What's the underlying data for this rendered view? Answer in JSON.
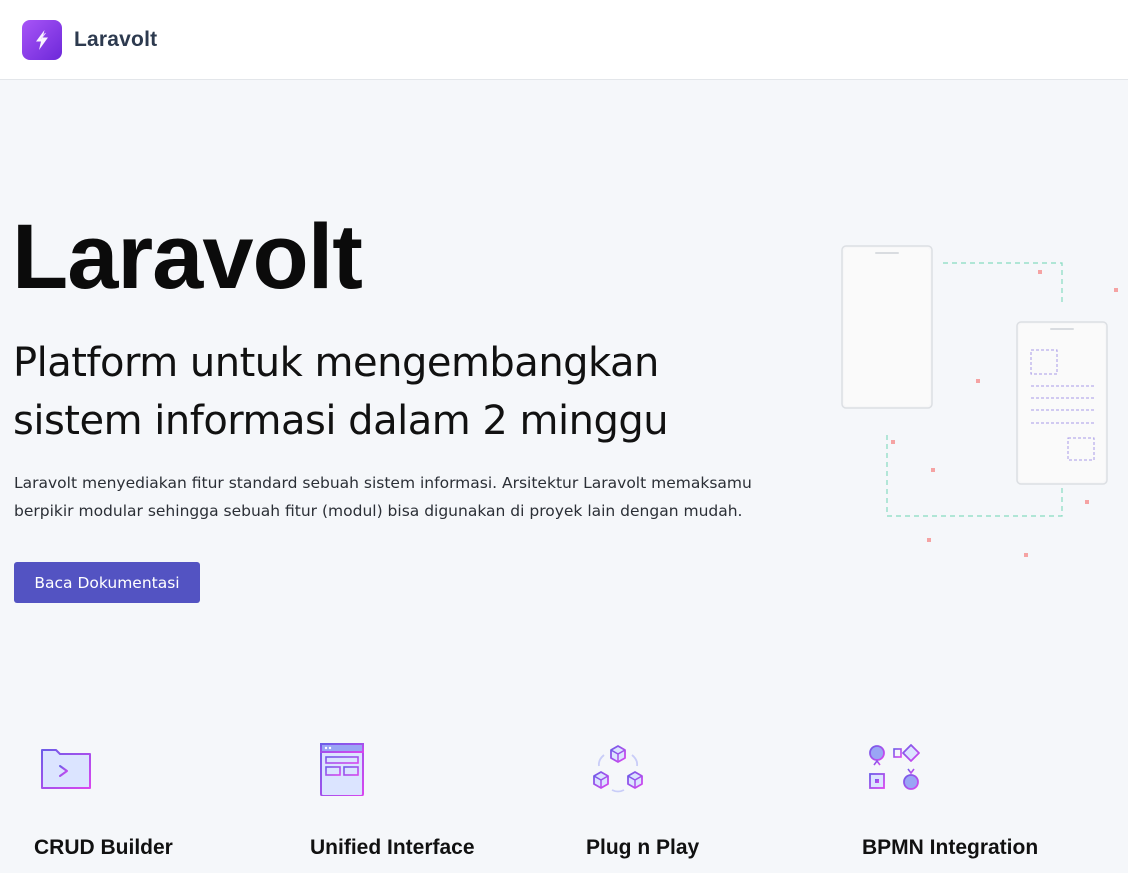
{
  "brand": {
    "name": "Laravolt"
  },
  "hero": {
    "title": "Laravolt",
    "subtitle_line1": "Platform untuk mengembangkan",
    "subtitle_line2": "sistem informasi dalam 2 minggu",
    "description_line1": "Laravolt menyediakan fitur standard sebuah sistem informasi. Arsitektur Laravolt memaksamu",
    "description_line2": "berpikir modular sehingga sebuah fitur (modul) bisa digunakan di proyek lain dengan mudah.",
    "cta_label": "Baca Dokumentasi"
  },
  "features": [
    {
      "title": "CRUD Builder",
      "icon": "folder-terminal-icon"
    },
    {
      "title": "Unified Interface",
      "icon": "layout-window-icon"
    },
    {
      "title": "Plug n Play",
      "icon": "cubes-icon"
    },
    {
      "title": "BPMN Integration",
      "icon": "workflow-icon"
    }
  ],
  "colors": {
    "accent": "#5353c2",
    "logo_gradient_start": "#a855f7",
    "logo_gradient_end": "#6d28d9",
    "icon_gradient_start": "#6d5ce8",
    "icon_gradient_end": "#d946ef"
  }
}
